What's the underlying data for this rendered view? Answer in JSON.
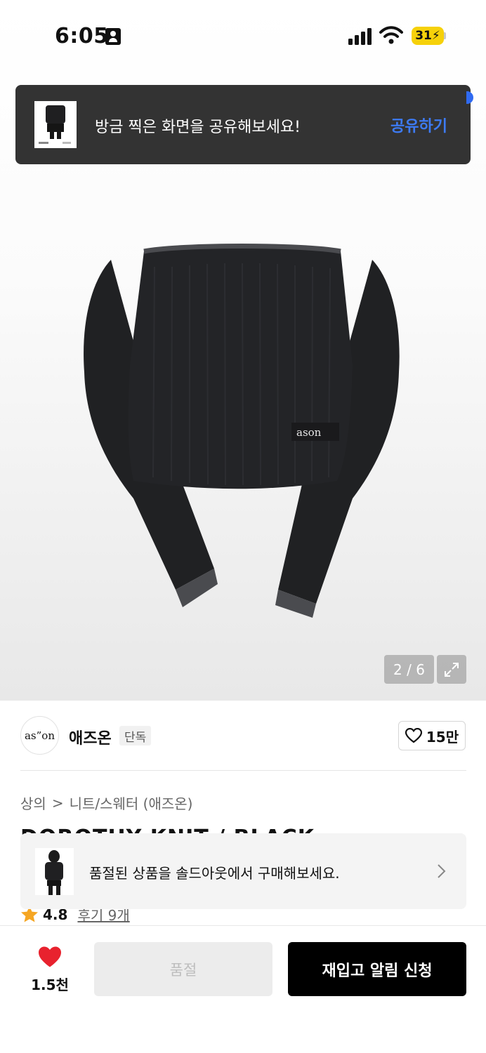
{
  "status_bar": {
    "time": "6:05",
    "battery": "31"
  },
  "share_toast": {
    "message": "방금 찍은 화면을 공유해보세요!",
    "action": "공유하기"
  },
  "gallery": {
    "counter": "2 / 6",
    "label_on_garment": "ason"
  },
  "brand": {
    "logo_text": "as”on",
    "name": "애즈온",
    "badge": "단독",
    "likes": "15만"
  },
  "breadcrumb": {
    "level1": "상의",
    "separator": ">",
    "level2": "니트/스웨터 (애즈온)"
  },
  "product": {
    "title": "DOROTHY KNIT / BLACK"
  },
  "soldout_banner": {
    "message": "품절된 상품을 솔드아웃에서 구매해보세요."
  },
  "rating": {
    "score": "4.8",
    "reviews": "후기 9개"
  },
  "bottom_bar": {
    "wish_count": "1.5천",
    "soldout_label": "품절",
    "restock_label": "재입고 알림 신청"
  },
  "colors": {
    "accent_blue": "#3d7bf5",
    "heart_red": "#e8222e",
    "star_orange": "#f5a623"
  }
}
